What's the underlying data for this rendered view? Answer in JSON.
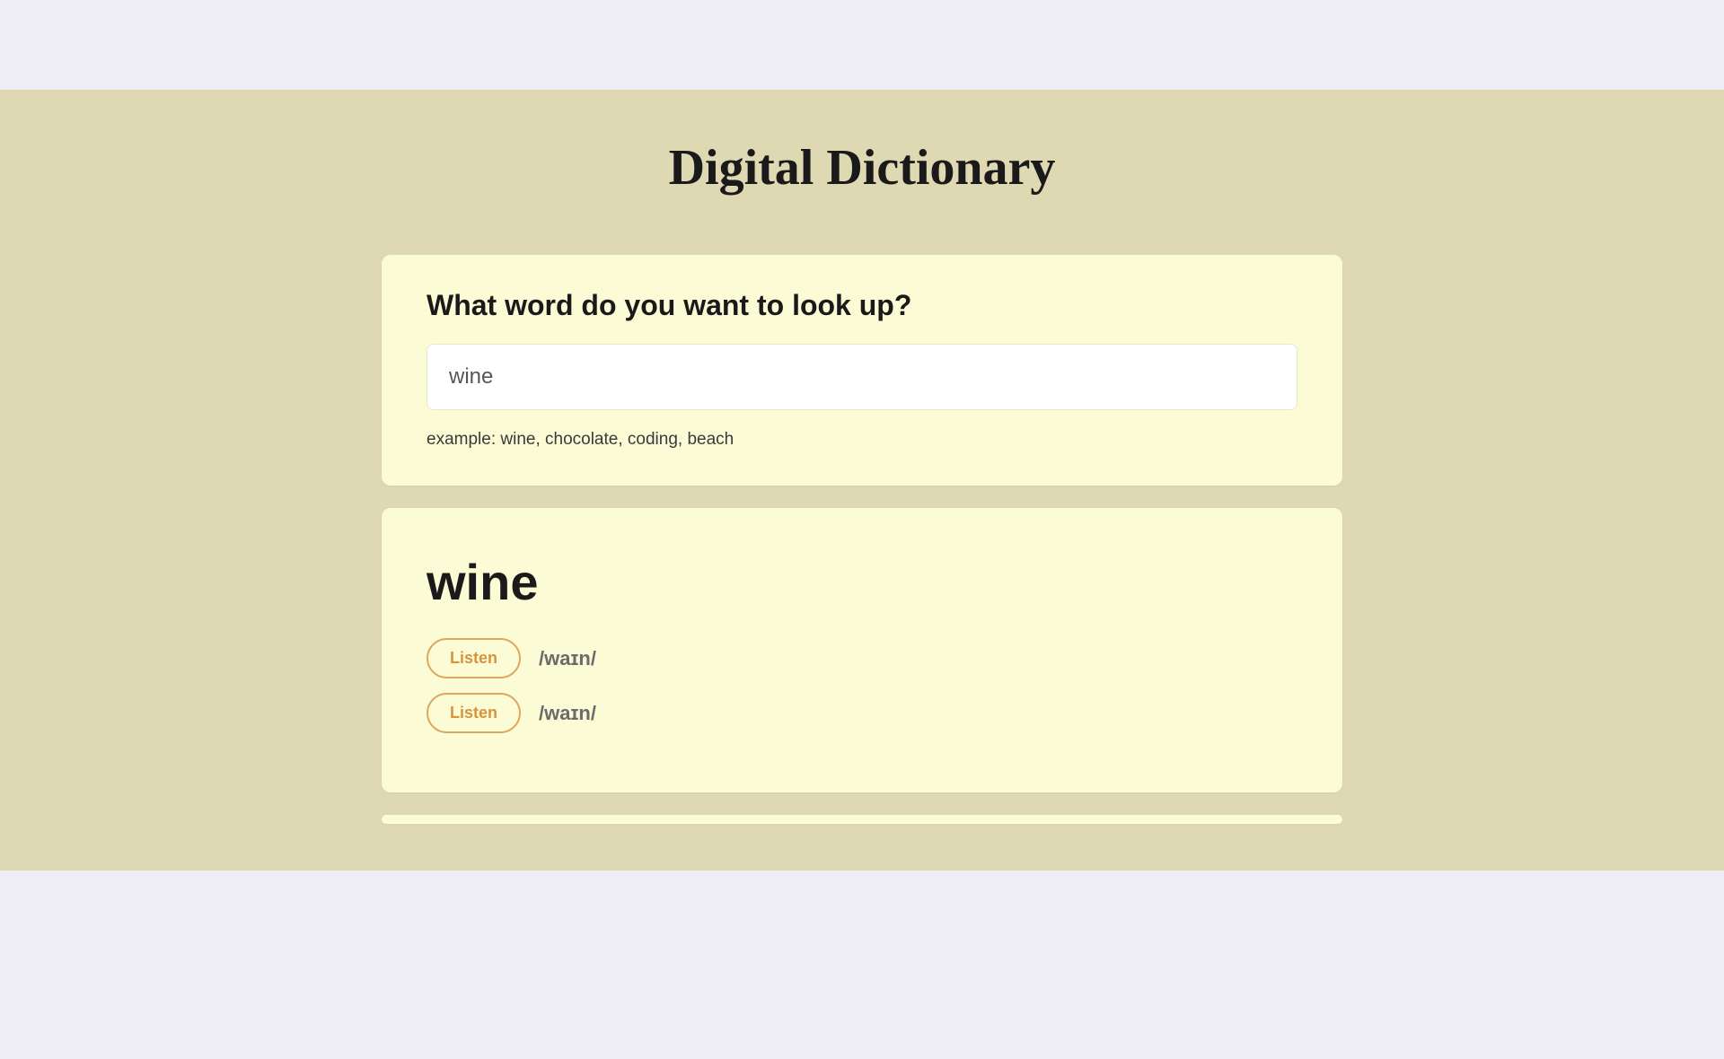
{
  "header": {
    "title": "Digital Dictionary"
  },
  "search": {
    "prompt": "What word do you want to look up?",
    "value": "wine",
    "placeholder": "",
    "hint": "example: wine, chocolate, coding, beach"
  },
  "result": {
    "word": "wine",
    "pronunciations": [
      {
        "button_label": "Listen",
        "phonetic": "/waɪn/"
      },
      {
        "button_label": "Listen",
        "phonetic": "/waɪn/"
      }
    ]
  }
}
